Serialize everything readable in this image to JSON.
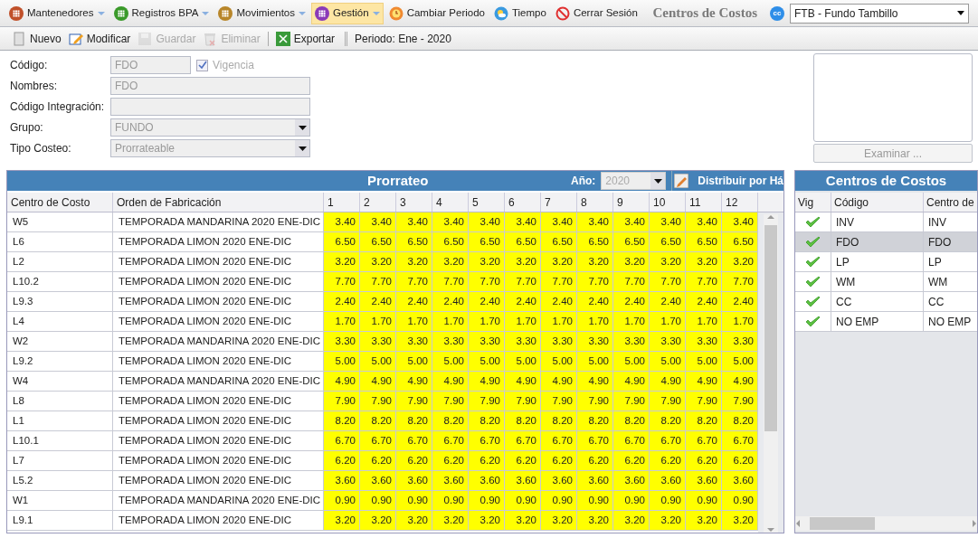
{
  "menu": [
    {
      "label": "Mantenedores",
      "color": "#c0502a",
      "dropdown": true,
      "selected": false
    },
    {
      "label": "Registros BPA",
      "color": "#3a9a2a",
      "dropdown": true,
      "selected": false
    },
    {
      "label": "Movimientos",
      "color": "#b8862a",
      "dropdown": true,
      "selected": false
    },
    {
      "label": "Gestión",
      "color": "#8a3ab8",
      "dropdown": true,
      "selected": true
    },
    {
      "label": "Cambiar Periodo",
      "kind": "clock",
      "dropdown": false,
      "selected": false
    },
    {
      "label": "Tiempo",
      "kind": "weather",
      "dropdown": false,
      "selected": false
    },
    {
      "label": "Cerrar Sesión",
      "kind": "stop",
      "dropdown": false,
      "selected": false
    }
  ],
  "page_title": "Centros de Costos",
  "company": {
    "badge": "cc",
    "value": "FTB - Fundo Tambillo"
  },
  "toolbar": [
    {
      "label": "Nuevo",
      "kind": "new",
      "disabled": false
    },
    {
      "label": "Modificar",
      "kind": "edit",
      "disabled": false
    },
    {
      "label": "Guardar",
      "kind": "save",
      "disabled": true
    },
    {
      "label": "Eliminar",
      "kind": "delete",
      "disabled": true
    },
    {
      "label": "Exportar",
      "kind": "excel",
      "disabled": false
    }
  ],
  "period": "Periodo: Ene - 2020",
  "form": {
    "codigo": {
      "label": "Código:",
      "value": "FDO"
    },
    "vigencia": {
      "label": "Vigencia",
      "checked": true
    },
    "nombres": {
      "label": "Nombres:",
      "value": "FDO"
    },
    "integracion": {
      "label": "Código Integración:"
    },
    "grupo": {
      "label": "Grupo:",
      "value": "FUNDO"
    },
    "tipo": {
      "label": "Tipo Costeo:",
      "value": "Prorrateable"
    }
  },
  "browse_button": "Examinar ...",
  "prorrateo": {
    "title": "Prorrateo",
    "year_label": "Año:",
    "year": "2020",
    "distribute_button": "Distribuir por Há",
    "columns": [
      "Centro de Costo",
      "Orden de Fabricación",
      "1",
      "2",
      "3",
      "4",
      "5",
      "6",
      "7",
      "8",
      "9",
      "10",
      "11",
      "12"
    ],
    "rows": [
      {
        "centro": "W5",
        "orden": "TEMPORADA MANDARINA 2020 ENE-DIC",
        "values": [
          "3.40",
          "3.40",
          "3.40",
          "3.40",
          "3.40",
          "3.40",
          "3.40",
          "3.40",
          "3.40",
          "3.40",
          "3.40",
          "3.40"
        ]
      },
      {
        "centro": "L6",
        "orden": "TEMPORADA LIMON 2020 ENE-DIC",
        "values": [
          "6.50",
          "6.50",
          "6.50",
          "6.50",
          "6.50",
          "6.50",
          "6.50",
          "6.50",
          "6.50",
          "6.50",
          "6.50",
          "6.50"
        ]
      },
      {
        "centro": "L2",
        "orden": "TEMPORADA LIMON 2020 ENE-DIC",
        "values": [
          "3.20",
          "3.20",
          "3.20",
          "3.20",
          "3.20",
          "3.20",
          "3.20",
          "3.20",
          "3.20",
          "3.20",
          "3.20",
          "3.20"
        ]
      },
      {
        "centro": "L10.2",
        "orden": "TEMPORADA LIMON 2020 ENE-DIC",
        "values": [
          "7.70",
          "7.70",
          "7.70",
          "7.70",
          "7.70",
          "7.70",
          "7.70",
          "7.70",
          "7.70",
          "7.70",
          "7.70",
          "7.70"
        ]
      },
      {
        "centro": "L9.3",
        "orden": "TEMPORADA LIMON 2020 ENE-DIC",
        "values": [
          "2.40",
          "2.40",
          "2.40",
          "2.40",
          "2.40",
          "2.40",
          "2.40",
          "2.40",
          "2.40",
          "2.40",
          "2.40",
          "2.40"
        ]
      },
      {
        "centro": "L4",
        "orden": "TEMPORADA LIMON 2020 ENE-DIC",
        "values": [
          "1.70",
          "1.70",
          "1.70",
          "1.70",
          "1.70",
          "1.70",
          "1.70",
          "1.70",
          "1.70",
          "1.70",
          "1.70",
          "1.70"
        ]
      },
      {
        "centro": "W2",
        "orden": "TEMPORADA MANDARINA 2020 ENE-DIC",
        "values": [
          "3.30",
          "3.30",
          "3.30",
          "3.30",
          "3.30",
          "3.30",
          "3.30",
          "3.30",
          "3.30",
          "3.30",
          "3.30",
          "3.30"
        ]
      },
      {
        "centro": "L9.2",
        "orden": "TEMPORADA LIMON 2020 ENE-DIC",
        "values": [
          "5.00",
          "5.00",
          "5.00",
          "5.00",
          "5.00",
          "5.00",
          "5.00",
          "5.00",
          "5.00",
          "5.00",
          "5.00",
          "5.00"
        ]
      },
      {
        "centro": "W4",
        "orden": "TEMPORADA MANDARINA 2020 ENE-DIC",
        "values": [
          "4.90",
          "4.90",
          "4.90",
          "4.90",
          "4.90",
          "4.90",
          "4.90",
          "4.90",
          "4.90",
          "4.90",
          "4.90",
          "4.90"
        ]
      },
      {
        "centro": "L8",
        "orden": "TEMPORADA LIMON 2020 ENE-DIC",
        "values": [
          "7.90",
          "7.90",
          "7.90",
          "7.90",
          "7.90",
          "7.90",
          "7.90",
          "7.90",
          "7.90",
          "7.90",
          "7.90",
          "7.90"
        ]
      },
      {
        "centro": "L1",
        "orden": "TEMPORADA LIMON 2020 ENE-DIC",
        "values": [
          "8.20",
          "8.20",
          "8.20",
          "8.20",
          "8.20",
          "8.20",
          "8.20",
          "8.20",
          "8.20",
          "8.20",
          "8.20",
          "8.20"
        ]
      },
      {
        "centro": "L10.1",
        "orden": "TEMPORADA LIMON 2020 ENE-DIC",
        "values": [
          "6.70",
          "6.70",
          "6.70",
          "6.70",
          "6.70",
          "6.70",
          "6.70",
          "6.70",
          "6.70",
          "6.70",
          "6.70",
          "6.70"
        ]
      },
      {
        "centro": "L7",
        "orden": "TEMPORADA LIMON 2020 ENE-DIC",
        "values": [
          "6.20",
          "6.20",
          "6.20",
          "6.20",
          "6.20",
          "6.20",
          "6.20",
          "6.20",
          "6.20",
          "6.20",
          "6.20",
          "6.20"
        ]
      },
      {
        "centro": "L5.2",
        "orden": "TEMPORADA LIMON 2020 ENE-DIC",
        "values": [
          "3.60",
          "3.60",
          "3.60",
          "3.60",
          "3.60",
          "3.60",
          "3.60",
          "3.60",
          "3.60",
          "3.60",
          "3.60",
          "3.60"
        ]
      },
      {
        "centro": "W1",
        "orden": "TEMPORADA MANDARINA 2020 ENE-DIC",
        "values": [
          "0.90",
          "0.90",
          "0.90",
          "0.90",
          "0.90",
          "0.90",
          "0.90",
          "0.90",
          "0.90",
          "0.90",
          "0.90",
          "0.90"
        ]
      },
      {
        "centro": "L9.1",
        "orden": "TEMPORADA LIMON 2020 ENE-DIC",
        "values": [
          "3.20",
          "3.20",
          "3.20",
          "3.20",
          "3.20",
          "3.20",
          "3.20",
          "3.20",
          "3.20",
          "3.20",
          "3.20",
          "3.20"
        ]
      }
    ]
  },
  "centros": {
    "title": "Centros de Costos",
    "columns": [
      "Vig",
      "Código",
      "Centro de"
    ],
    "rows": [
      {
        "vigente": true,
        "codigo": "INV",
        "centro": "INV",
        "selected": false
      },
      {
        "vigente": true,
        "codigo": "FDO",
        "centro": "FDO",
        "selected": true
      },
      {
        "vigente": true,
        "codigo": "LP",
        "centro": "LP",
        "selected": false
      },
      {
        "vigente": true,
        "codigo": "WM",
        "centro": "WM",
        "selected": false
      },
      {
        "vigente": true,
        "codigo": "CC",
        "centro": "CC",
        "selected": false
      },
      {
        "vigente": true,
        "codigo": "NO EMP",
        "centro": "NO EMP",
        "selected": false
      }
    ]
  }
}
